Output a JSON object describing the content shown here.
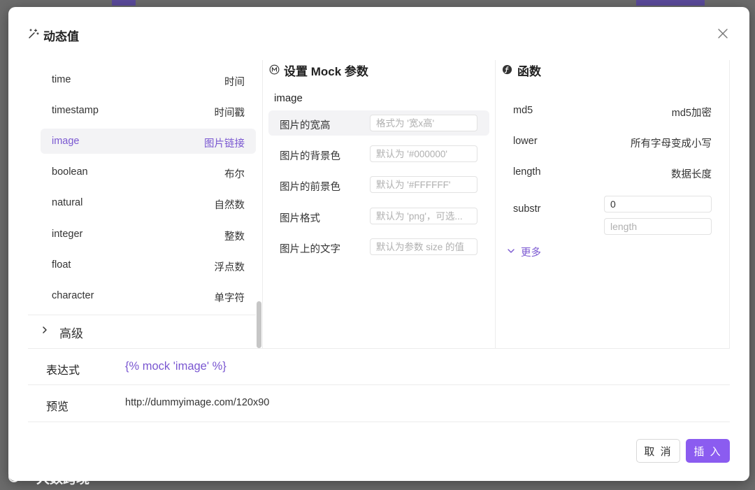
{
  "dialog": {
    "title": "动态值",
    "colors": {
      "accent": "#7a57d1",
      "primary_button": "#8b5cf0"
    }
  },
  "left_list": {
    "items": [
      {
        "key": "time",
        "label": "时间",
        "active": false
      },
      {
        "key": "timestamp",
        "label": "时间戳",
        "active": false
      },
      {
        "key": "image",
        "label": "图片链接",
        "active": true
      },
      {
        "key": "boolean",
        "label": "布尔",
        "active": false
      },
      {
        "key": "natural",
        "label": "自然数",
        "active": false
      },
      {
        "key": "integer",
        "label": "整数",
        "active": false
      },
      {
        "key": "float",
        "label": "浮点数",
        "active": false
      },
      {
        "key": "character",
        "label": "单字符",
        "active": false
      }
    ],
    "advanced_label": "高级"
  },
  "mock_params": {
    "title": "设置 Mock 参数",
    "subtitle": "image",
    "params": [
      {
        "label": "图片的宽高",
        "placeholder": "格式为 '宽x高'",
        "active": true
      },
      {
        "label": "图片的背景色",
        "placeholder": "默认为 '#000000'",
        "active": false
      },
      {
        "label": "图片的前景色",
        "placeholder": "默认为 '#FFFFFF'",
        "active": false
      },
      {
        "label": "图片格式",
        "placeholder": "默认为 'png'，可选...",
        "active": false
      },
      {
        "label": "图片上的文字",
        "placeholder": "默认为参数 size 的值",
        "active": false
      }
    ]
  },
  "functions": {
    "title": "函数",
    "items": [
      {
        "key": "md5",
        "label": "md5加密"
      },
      {
        "key": "lower",
        "label": "所有字母变成小写"
      },
      {
        "key": "length",
        "label": "数据长度"
      }
    ],
    "substr": {
      "label": "substr",
      "start_value": "0",
      "length_placeholder": "length"
    },
    "more_label": "更多"
  },
  "expression": {
    "label": "表达式",
    "value": "{% mock 'image' %}"
  },
  "preview": {
    "label": "预览",
    "value": "http://dummyimage.com/120x90"
  },
  "buttons": {
    "cancel": "取 消",
    "insert": "插 入"
  },
  "watermark": {
    "text": "大数跨境"
  }
}
